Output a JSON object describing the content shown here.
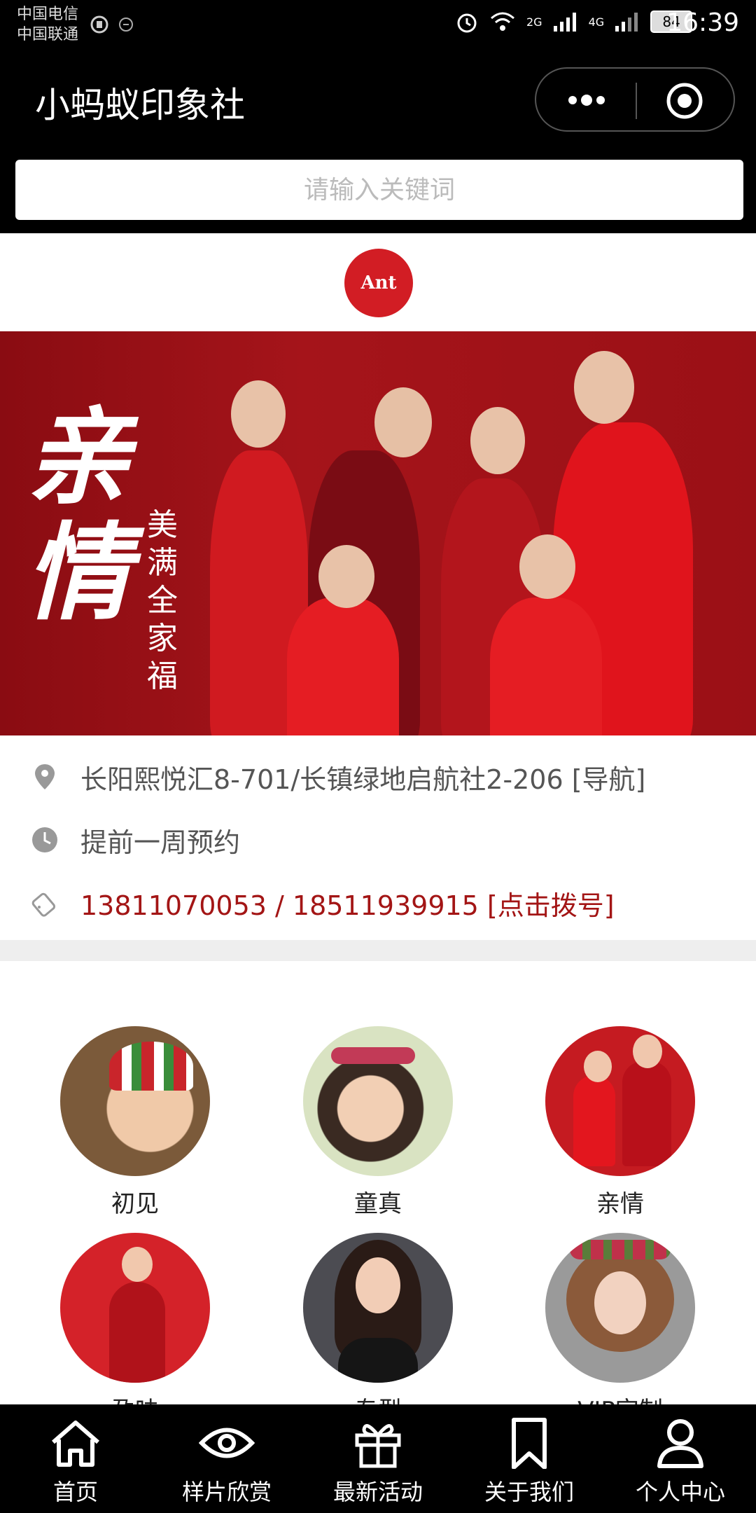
{
  "status_bar": {
    "carrier_1": "中国电信",
    "carrier_2": "中国联通",
    "battery": "84",
    "time": "16:39",
    "signal_1_label": "2G",
    "signal_2_label": "4G"
  },
  "header": {
    "title": "小蚂蚁印象社"
  },
  "search": {
    "placeholder": "请输入关键词"
  },
  "logo": {
    "text": "Ant"
  },
  "banner": {
    "main_char_1": "亲",
    "main_char_2": "情",
    "vertical_text": "美满全家福"
  },
  "info": {
    "address": "长阳熙悦汇8-701/长镇绿地启航社2-206 [导航]",
    "booking": "提前一周预约",
    "phone": "13811070053 / 18511939915 [点击拨号]"
  },
  "categories": [
    {
      "label": "初见"
    },
    {
      "label": "童真"
    },
    {
      "label": "亲情"
    },
    {
      "label": "孕味"
    },
    {
      "label": "专型"
    },
    {
      "label": "VIP定制"
    }
  ],
  "tabs": [
    {
      "label": "首页",
      "icon": "home-icon"
    },
    {
      "label": "样片欣赏",
      "icon": "eye-icon"
    },
    {
      "label": "最新活动",
      "icon": "gift-icon"
    },
    {
      "label": "关于我们",
      "icon": "bookmark-icon"
    },
    {
      "label": "个人中心",
      "icon": "person-icon"
    }
  ],
  "colors": {
    "brand_red": "#d21d24",
    "phone_red": "#a31515",
    "bar_black": "#000000"
  }
}
